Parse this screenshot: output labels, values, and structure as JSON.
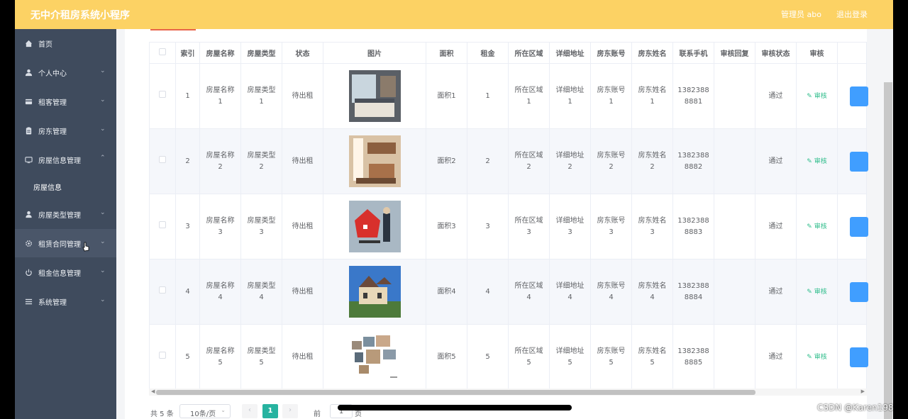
{
  "header": {
    "title": "无中介租房系统小程序",
    "admin": "管理员 abo",
    "logout": "退出登录"
  },
  "sidebar": {
    "items": [
      {
        "label": "首页",
        "icon": "home-icon",
        "chevron": ""
      },
      {
        "label": "个人中心",
        "icon": "user-icon",
        "chevron": "⌄"
      },
      {
        "label": "租客管理",
        "icon": "card-icon",
        "chevron": "⌄"
      },
      {
        "label": "房东管理",
        "icon": "clipboard-icon",
        "chevron": "⌄"
      },
      {
        "label": "房屋信息管理",
        "icon": "monitor-icon",
        "chevron": "⌃"
      },
      {
        "label": "房屋信息",
        "icon": "",
        "chevron": ""
      },
      {
        "label": "房屋类型管理",
        "icon": "person-icon",
        "chevron": "⌄"
      },
      {
        "label": "租赁合同管理",
        "icon": "gear-icon",
        "chevron": "⌄"
      },
      {
        "label": "租金信息管理",
        "icon": "power-icon",
        "chevron": "⌄"
      },
      {
        "label": "系统管理",
        "icon": "menu-icon",
        "chevron": "⌄"
      }
    ]
  },
  "table": {
    "headers": [
      "",
      "索引",
      "房屋名称",
      "房屋类型",
      "状态",
      "图片",
      "面积",
      "租金",
      "所在区域",
      "详细地址",
      "房东账号",
      "房东姓名",
      "联系手机",
      "审核回复",
      "审核状态",
      "审核",
      ""
    ],
    "rows": [
      {
        "index": "1",
        "name": [
          "房屋名称",
          "1"
        ],
        "type": [
          "房屋类型",
          "1"
        ],
        "status": "待出租",
        "area": "面积1",
        "rent": "1",
        "region": [
          "所在区域",
          "1"
        ],
        "address": [
          "详细地址",
          "1"
        ],
        "account": [
          "房东账号",
          "1"
        ],
        "owner": [
          "房东姓名",
          "1"
        ],
        "phone": [
          "1382388",
          "8881"
        ],
        "reply": "",
        "audit_status": "通过",
        "audit": "审核"
      },
      {
        "index": "2",
        "name": [
          "房屋名称",
          "2"
        ],
        "type": [
          "房屋类型",
          "2"
        ],
        "status": "待出租",
        "area": "面积2",
        "rent": "2",
        "region": [
          "所在区域",
          "2"
        ],
        "address": [
          "详细地址",
          "2"
        ],
        "account": [
          "房东账号",
          "2"
        ],
        "owner": [
          "房东姓名",
          "2"
        ],
        "phone": [
          "1382388",
          "8882"
        ],
        "reply": "",
        "audit_status": "通过",
        "audit": "审核"
      },
      {
        "index": "3",
        "name": [
          "房屋名称",
          "3"
        ],
        "type": [
          "房屋类型",
          "3"
        ],
        "status": "待出租",
        "area": "面积3",
        "rent": "3",
        "region": [
          "所在区域",
          "3"
        ],
        "address": [
          "详细地址",
          "3"
        ],
        "account": [
          "房东账号",
          "3"
        ],
        "owner": [
          "房东姓名",
          "3"
        ],
        "phone": [
          "1382388",
          "8883"
        ],
        "reply": "",
        "audit_status": "通过",
        "audit": "审核"
      },
      {
        "index": "4",
        "name": [
          "房屋名称",
          "4"
        ],
        "type": [
          "房屋类型",
          "4"
        ],
        "status": "待出租",
        "area": "面积4",
        "rent": "4",
        "region": [
          "所在区域",
          "4"
        ],
        "address": [
          "详细地址",
          "4"
        ],
        "account": [
          "房东账号",
          "4"
        ],
        "owner": [
          "房东姓名",
          "4"
        ],
        "phone": [
          "1382388",
          "8884"
        ],
        "reply": "",
        "audit_status": "通过",
        "audit": "审核"
      },
      {
        "index": "5",
        "name": [
          "房屋名称",
          "5"
        ],
        "type": [
          "房屋类型",
          "5"
        ],
        "status": "待出租",
        "area": "面积5",
        "rent": "5",
        "region": [
          "所在区域",
          "5"
        ],
        "address": [
          "详细地址",
          "5"
        ],
        "account": [
          "房东账号",
          "5"
        ],
        "owner": [
          "房东姓名",
          "5"
        ],
        "phone": [
          "1382388",
          "8885"
        ],
        "reply": "",
        "audit_status": "通过",
        "audit": "审核"
      }
    ]
  },
  "pagination": {
    "total": "共 5 条",
    "page_size": "10条/页",
    "current": "1",
    "goto_label": "前往",
    "goto_value": "1",
    "page_word": "页"
  },
  "watermark": "CSDN @Karen198",
  "colors": {
    "header": "#fcd264",
    "sidebar": "#3f4b5d",
    "accent": "#27b3a0",
    "audit": "#2fbd8b",
    "button": "#409eff"
  }
}
